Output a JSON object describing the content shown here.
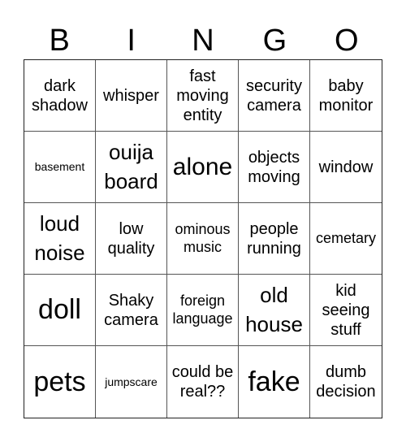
{
  "header": {
    "letters": [
      "B",
      "I",
      "N",
      "G",
      "O"
    ]
  },
  "cells": [
    "dark shadow",
    "whisper",
    "fast moving entity",
    "security camera",
    "baby monitor",
    "basement",
    "ouija board",
    "alone",
    "objects moving",
    "window",
    "loud noise",
    "low quality",
    "ominous music",
    "people running",
    "cemetary",
    "doll",
    "Shaky camera",
    "foreign language",
    "old house",
    "kid seeing stuff",
    "pets",
    "jumpscare",
    "could be real??",
    "fake",
    "dumb decision"
  ]
}
